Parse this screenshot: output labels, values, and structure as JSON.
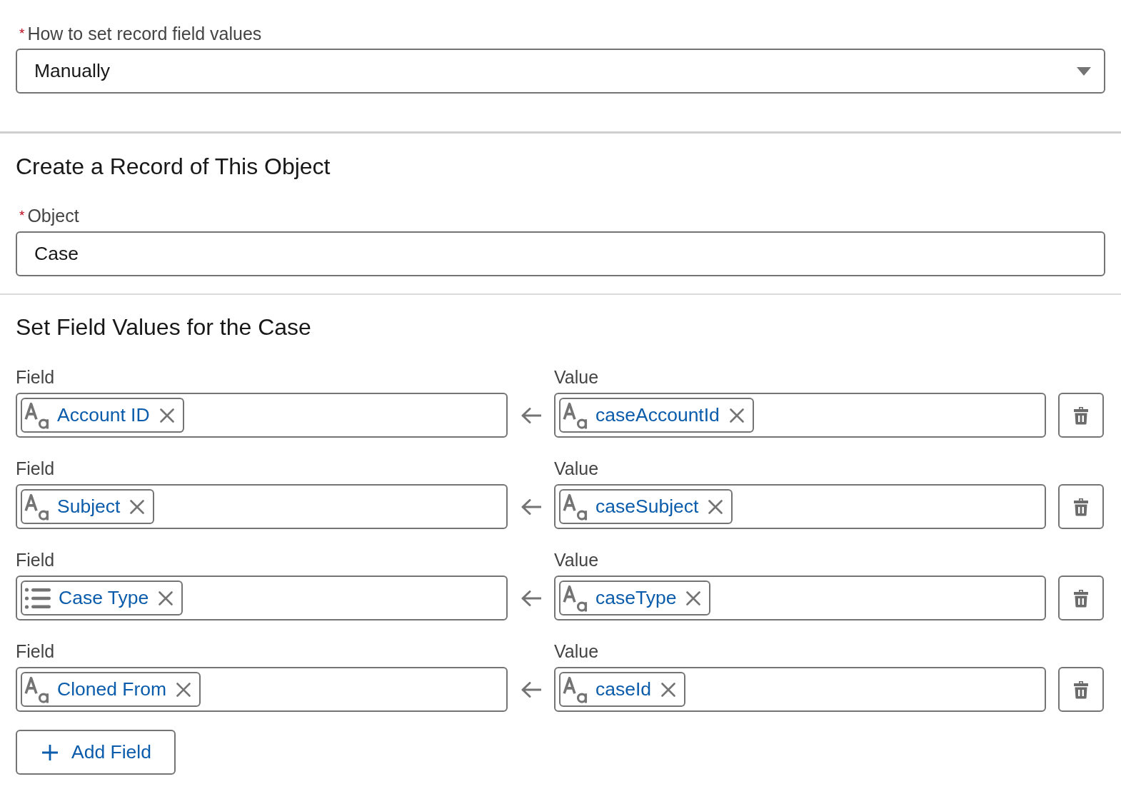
{
  "how_to_set": {
    "required_mark": "*",
    "label": "How to set record field values",
    "value": "Manually"
  },
  "create_record": {
    "heading": "Create a Record of This Object",
    "object": {
      "required_mark": "*",
      "label": "Object",
      "value": "Case"
    }
  },
  "set_field_values": {
    "heading": "Set Field Values for the Case",
    "rows": [
      {
        "field_label": "Field",
        "field": {
          "kind": "text",
          "label": "Account ID"
        },
        "value_label": "Value",
        "value": {
          "kind": "text",
          "label": "caseAccountId"
        }
      },
      {
        "field_label": "Field",
        "field": {
          "kind": "text",
          "label": "Subject"
        },
        "value_label": "Value",
        "value": {
          "kind": "text",
          "label": "caseSubject"
        }
      },
      {
        "field_label": "Field",
        "field": {
          "kind": "picklist",
          "label": "Case Type"
        },
        "value_label": "Value",
        "value": {
          "kind": "text",
          "label": "caseType"
        }
      },
      {
        "field_label": "Field",
        "field": {
          "kind": "text",
          "label": "Cloned From"
        },
        "value_label": "Value",
        "value": {
          "kind": "text",
          "label": "caseId"
        }
      }
    ],
    "add_button": "Add Field"
  }
}
